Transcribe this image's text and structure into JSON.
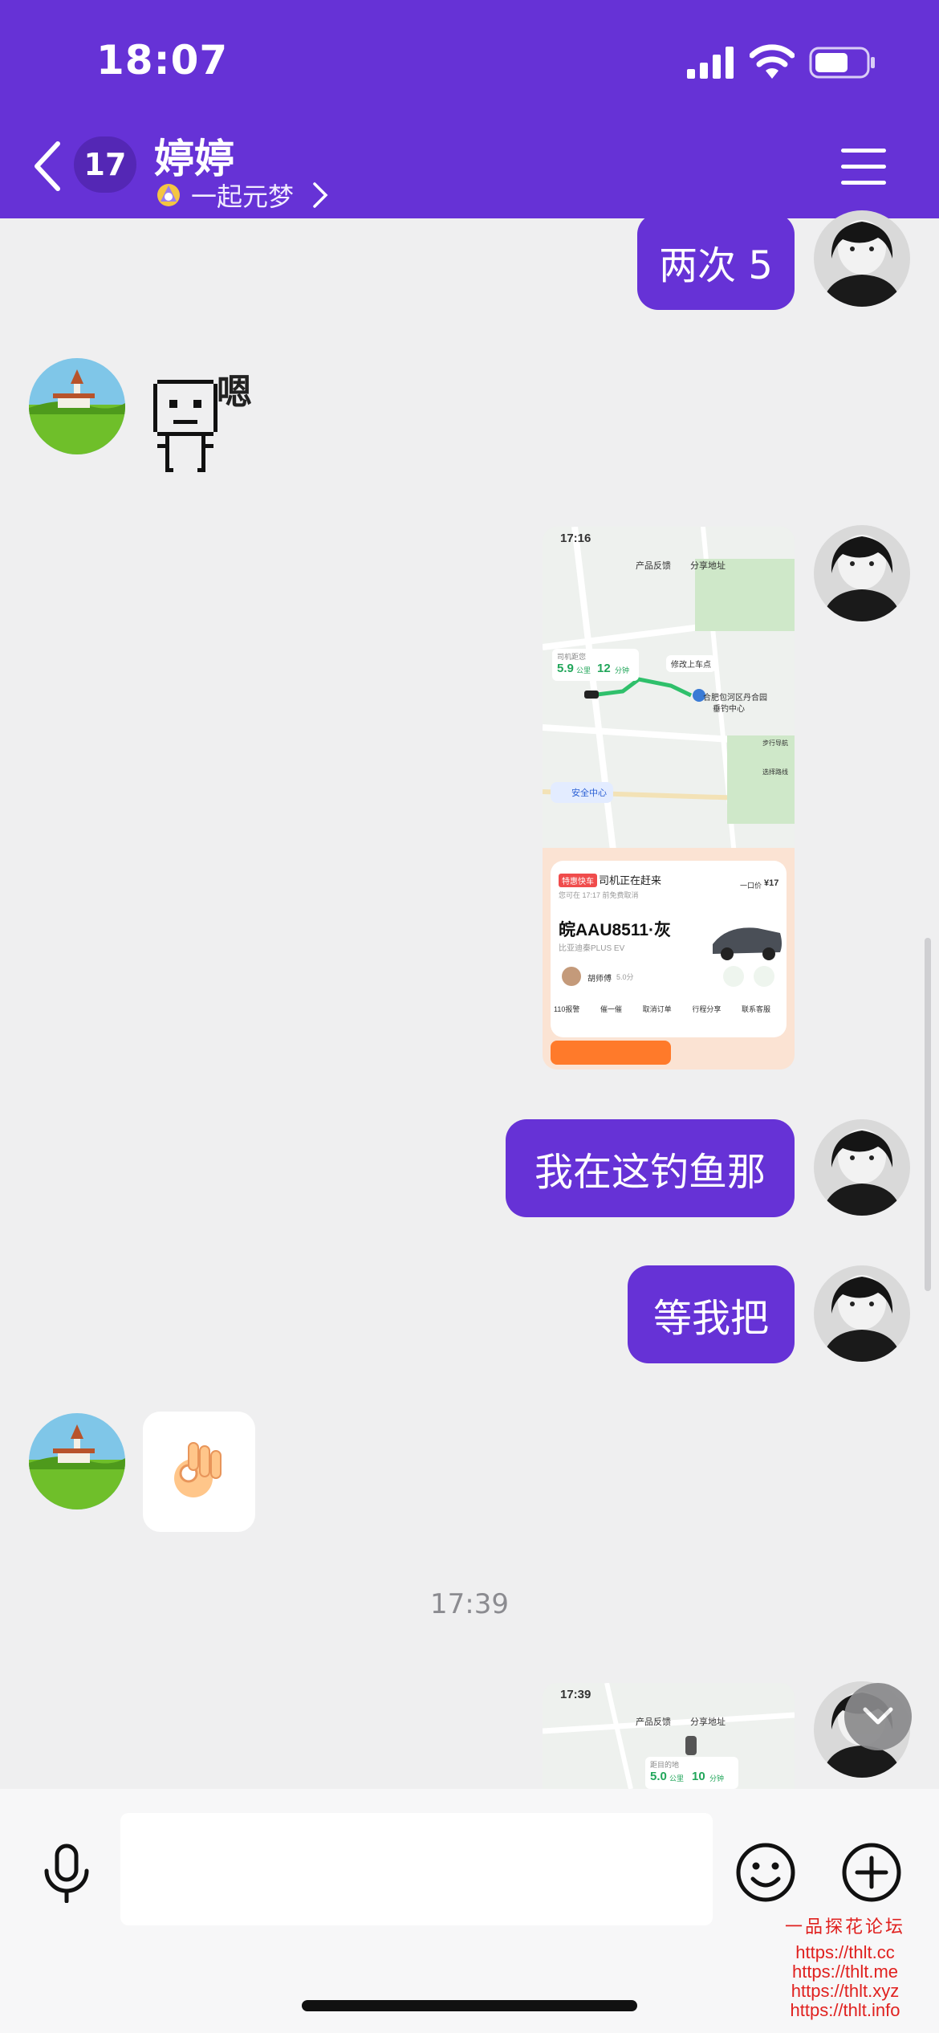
{
  "status_bar": {
    "time": "18:07"
  },
  "header": {
    "unread_count": "17",
    "title": "婷婷",
    "status_label": "一起元梦",
    "colors": {
      "header_bg": "#6632d6",
      "bubble_out": "#6632d6"
    }
  },
  "messages": {
    "m1": "两次 5",
    "m2_sticker_text": "嗯",
    "m4": "我在这钓鱼那",
    "m5": "等我把",
    "m6_emoji": "👌",
    "time_divider": "17:39"
  },
  "ride_screenshot_1": {
    "status_time": "17:16",
    "feedback": "产品反馈",
    "share_location": "分享地址",
    "distance_label": "司机距您",
    "distance": "5.9",
    "distance_unit": "公里",
    "minutes": "12",
    "minutes_unit": "分钟",
    "change_pickup": "修改上车点",
    "pickup_name": "合肥包河区丹合园",
    "pickup_sub": "垂钓中心",
    "safety_center": "安全中心",
    "walk_nav": "步行导航",
    "route": "选择路线",
    "car_type_badge": "特惠快车",
    "driver_status": "司机正在赶来",
    "fixed_price_label": "一口价",
    "fixed_price": "¥17",
    "wait_note": "您可在 17:17 前免费取消",
    "plate": "皖AAU8511·灰",
    "car_model": "比亚迪秦PLUS EV",
    "driver_name": "胡师傅",
    "driver_rating": "5.0分",
    "actions": [
      "110报警",
      "催一催",
      "取消订单",
      "行程分享",
      "联系客服"
    ]
  },
  "ride_screenshot_2": {
    "status_time": "17:39",
    "feedback": "产品反馈",
    "share_location": "分享地址",
    "distance_label": "距目的地",
    "distance": "5.0",
    "distance_unit": "公里",
    "minutes": "10",
    "minutes_unit": "分钟"
  },
  "input": {
    "placeholder": ""
  },
  "watermark": {
    "title": "一品探花论坛",
    "urls": [
      "https://thlt.cc",
      "https://thlt.me",
      "https://thlt.xyz",
      "https://thlt.info"
    ]
  }
}
